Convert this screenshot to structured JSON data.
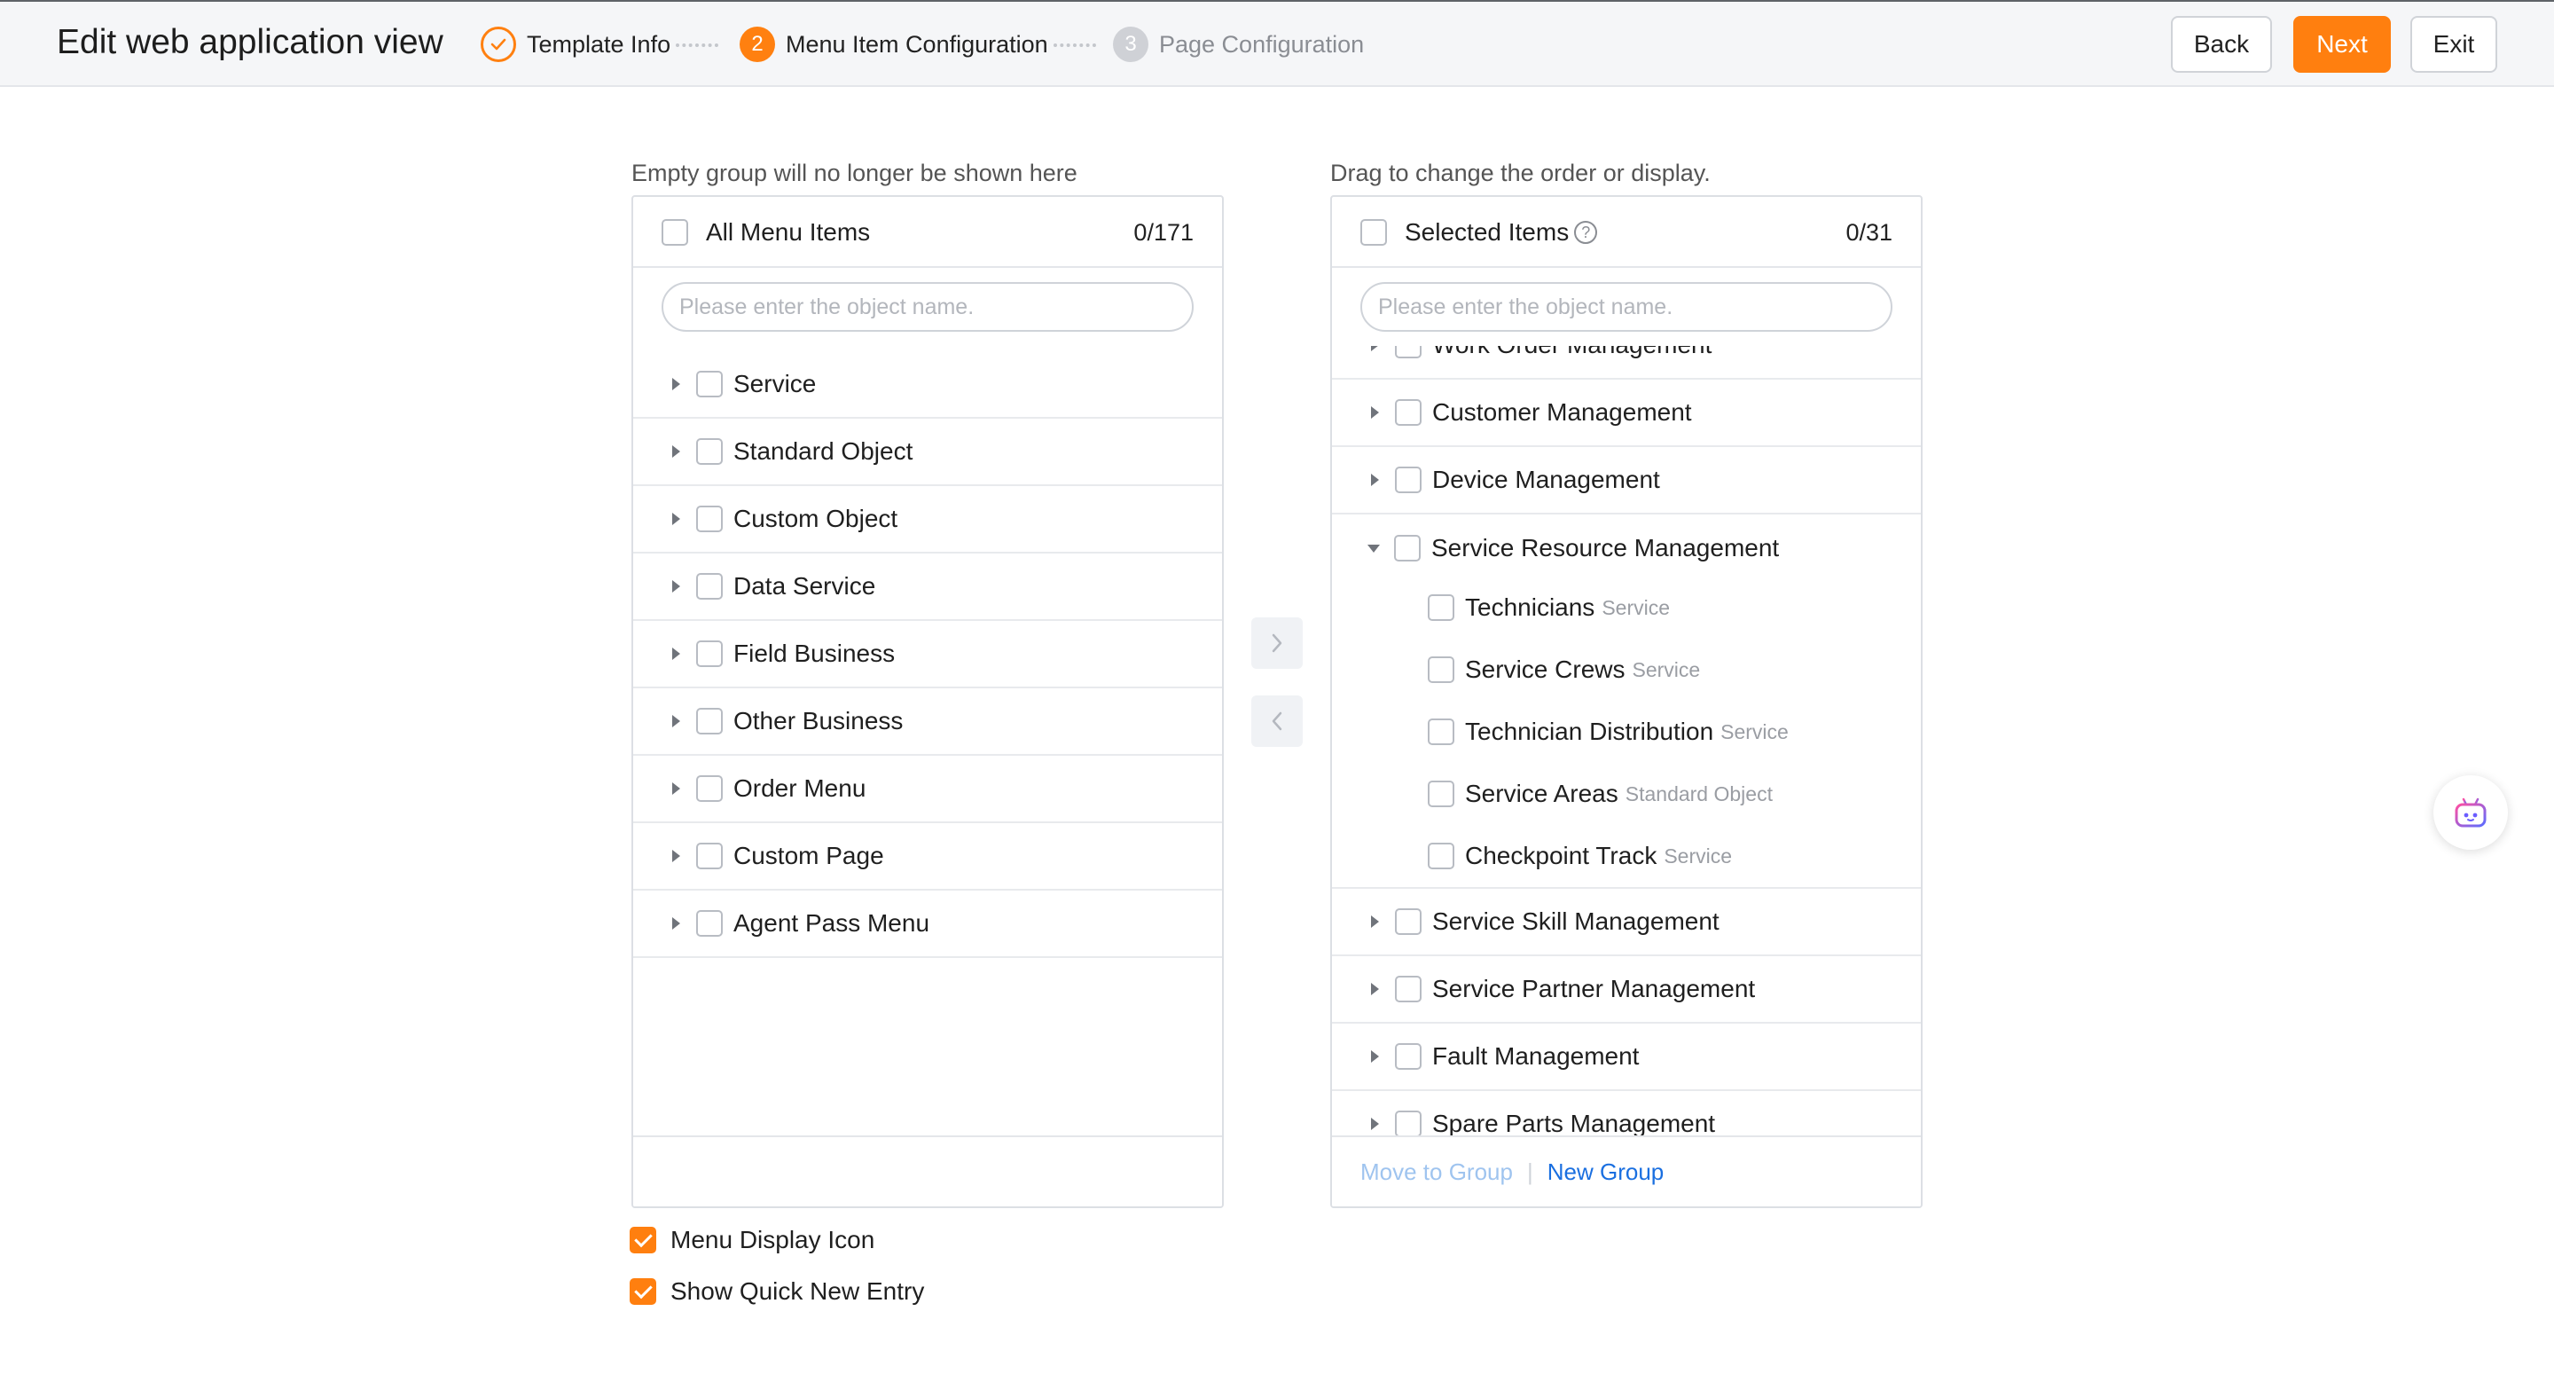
{
  "header": {
    "title": "Edit web application view",
    "steps": [
      {
        "number": "",
        "label": "Template Info",
        "state": "done"
      },
      {
        "number": "2",
        "label": "Menu Item Configuration",
        "state": "active"
      },
      {
        "number": "3",
        "label": "Page Configuration",
        "state": "pending"
      }
    ],
    "buttons": {
      "back": "Back",
      "next": "Next",
      "exit": "Exit"
    }
  },
  "left_panel": {
    "hint": "Empty group will no longer be shown here",
    "header_label": "All Menu Items",
    "count": "0/171",
    "search_placeholder": "Please enter the object name.",
    "items": [
      "Service",
      "Standard Object",
      "Custom Object",
      "Data Service",
      "Field Business",
      "Other Business",
      "Order Menu",
      "Custom Page",
      "Agent Pass Menu"
    ]
  },
  "right_panel": {
    "hint": "Drag to change the order or display.",
    "header_label": "Selected Items",
    "count": "0/31",
    "search_placeholder": "Please enter the object name.",
    "groups": [
      {
        "label": "Work Order Management",
        "expanded": false
      },
      {
        "label": "Customer Management",
        "expanded": false
      },
      {
        "label": "Device Management",
        "expanded": false
      },
      {
        "label": "Service Resource Management",
        "expanded": true
      },
      {
        "label": "Service Skill Management",
        "expanded": false
      },
      {
        "label": "Service Partner Management",
        "expanded": false
      },
      {
        "label": "Fault Management",
        "expanded": false
      },
      {
        "label": "Spare Parts Management",
        "expanded": false
      }
    ],
    "children": [
      {
        "label": "Technicians",
        "type": "Service"
      },
      {
        "label": "Service Crews",
        "type": "Service"
      },
      {
        "label": "Technician Distribution",
        "type": "Service"
      },
      {
        "label": "Service Areas",
        "type": "Standard Object"
      },
      {
        "label": "Checkpoint Track",
        "type": "Service"
      }
    ],
    "footer": {
      "move_to_group": "Move to Group",
      "new_group": "New Group"
    }
  },
  "transfer": {
    "right_icon": "chevron-right-icon",
    "left_icon": "chevron-left-icon"
  },
  "options": [
    {
      "label": "Menu Display Icon",
      "checked": true
    },
    {
      "label": "Show Quick New Entry",
      "checked": true
    }
  ],
  "floating_assistant": {
    "icon": "robot-assistant-icon"
  },
  "colors": {
    "accent": "#ff7f0f",
    "link": "#1a6fe0",
    "link_disabled": "#9fc4ef"
  }
}
